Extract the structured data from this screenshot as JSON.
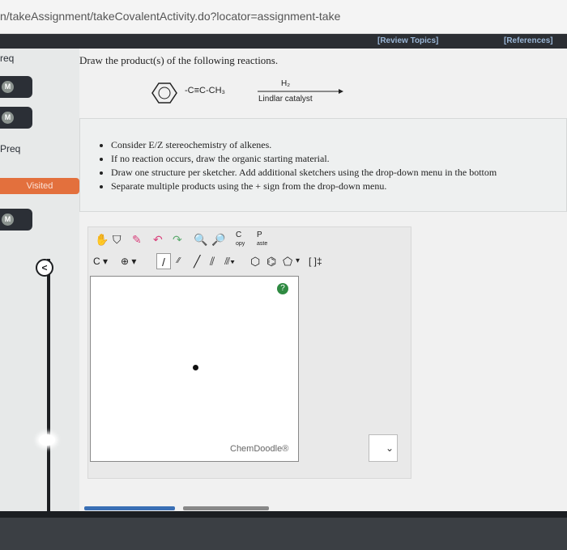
{
  "browser": {
    "url": "n/takeAssignment/takeCovalentActivity.do?locator=assignment-take"
  },
  "header": {
    "review_topics": "[Review Topics]",
    "references": "[References]"
  },
  "left": {
    "labels": [
      "req",
      "Preq"
    ],
    "badges": [
      "M",
      "M",
      "M"
    ],
    "visited": "Visited"
  },
  "question": {
    "prompt": "Draw the product(s) of the following reactions.",
    "substituent": "-C≡C-CH₃",
    "reagent": "H₂",
    "catalyst": "Lindlar catalyst"
  },
  "instructions": [
    "Consider E/Z stereochemistry of alkenes.",
    "If no reaction occurs, draw the organic starting material.",
    "Draw one structure per sketcher. Add additional sketchers using the drop-down menu in the bottom",
    "Separate multiple products using the + sign from the drop-down menu."
  ],
  "toolbar": {
    "copy_top": "C",
    "copy_bottom": "opy",
    "paste_top": "P",
    "paste_bottom": "aste",
    "carbon": "C",
    "charge": "⊕",
    "bracket": "[ ]‡"
  },
  "sketcher": {
    "help": "?",
    "brand": "ChemDoodle®"
  },
  "dropdown": {
    "chevron": "⌄"
  },
  "icons": [
    "hand-icon",
    "lasso-icon",
    "eraser-icon",
    "undo-icon",
    "redo-icon",
    "zoom-in-icon",
    "zoom-out-icon",
    "clean-icon",
    "single-bond-icon",
    "double-bond-icon",
    "triangle-icon",
    "cyclopentane-icon",
    "benzene-icon"
  ],
  "colors": {
    "accent_orange": "#e3703d",
    "dark": "#2b2e33",
    "help_green": "#2f8a42",
    "link_blue": "#9ab6d6"
  }
}
